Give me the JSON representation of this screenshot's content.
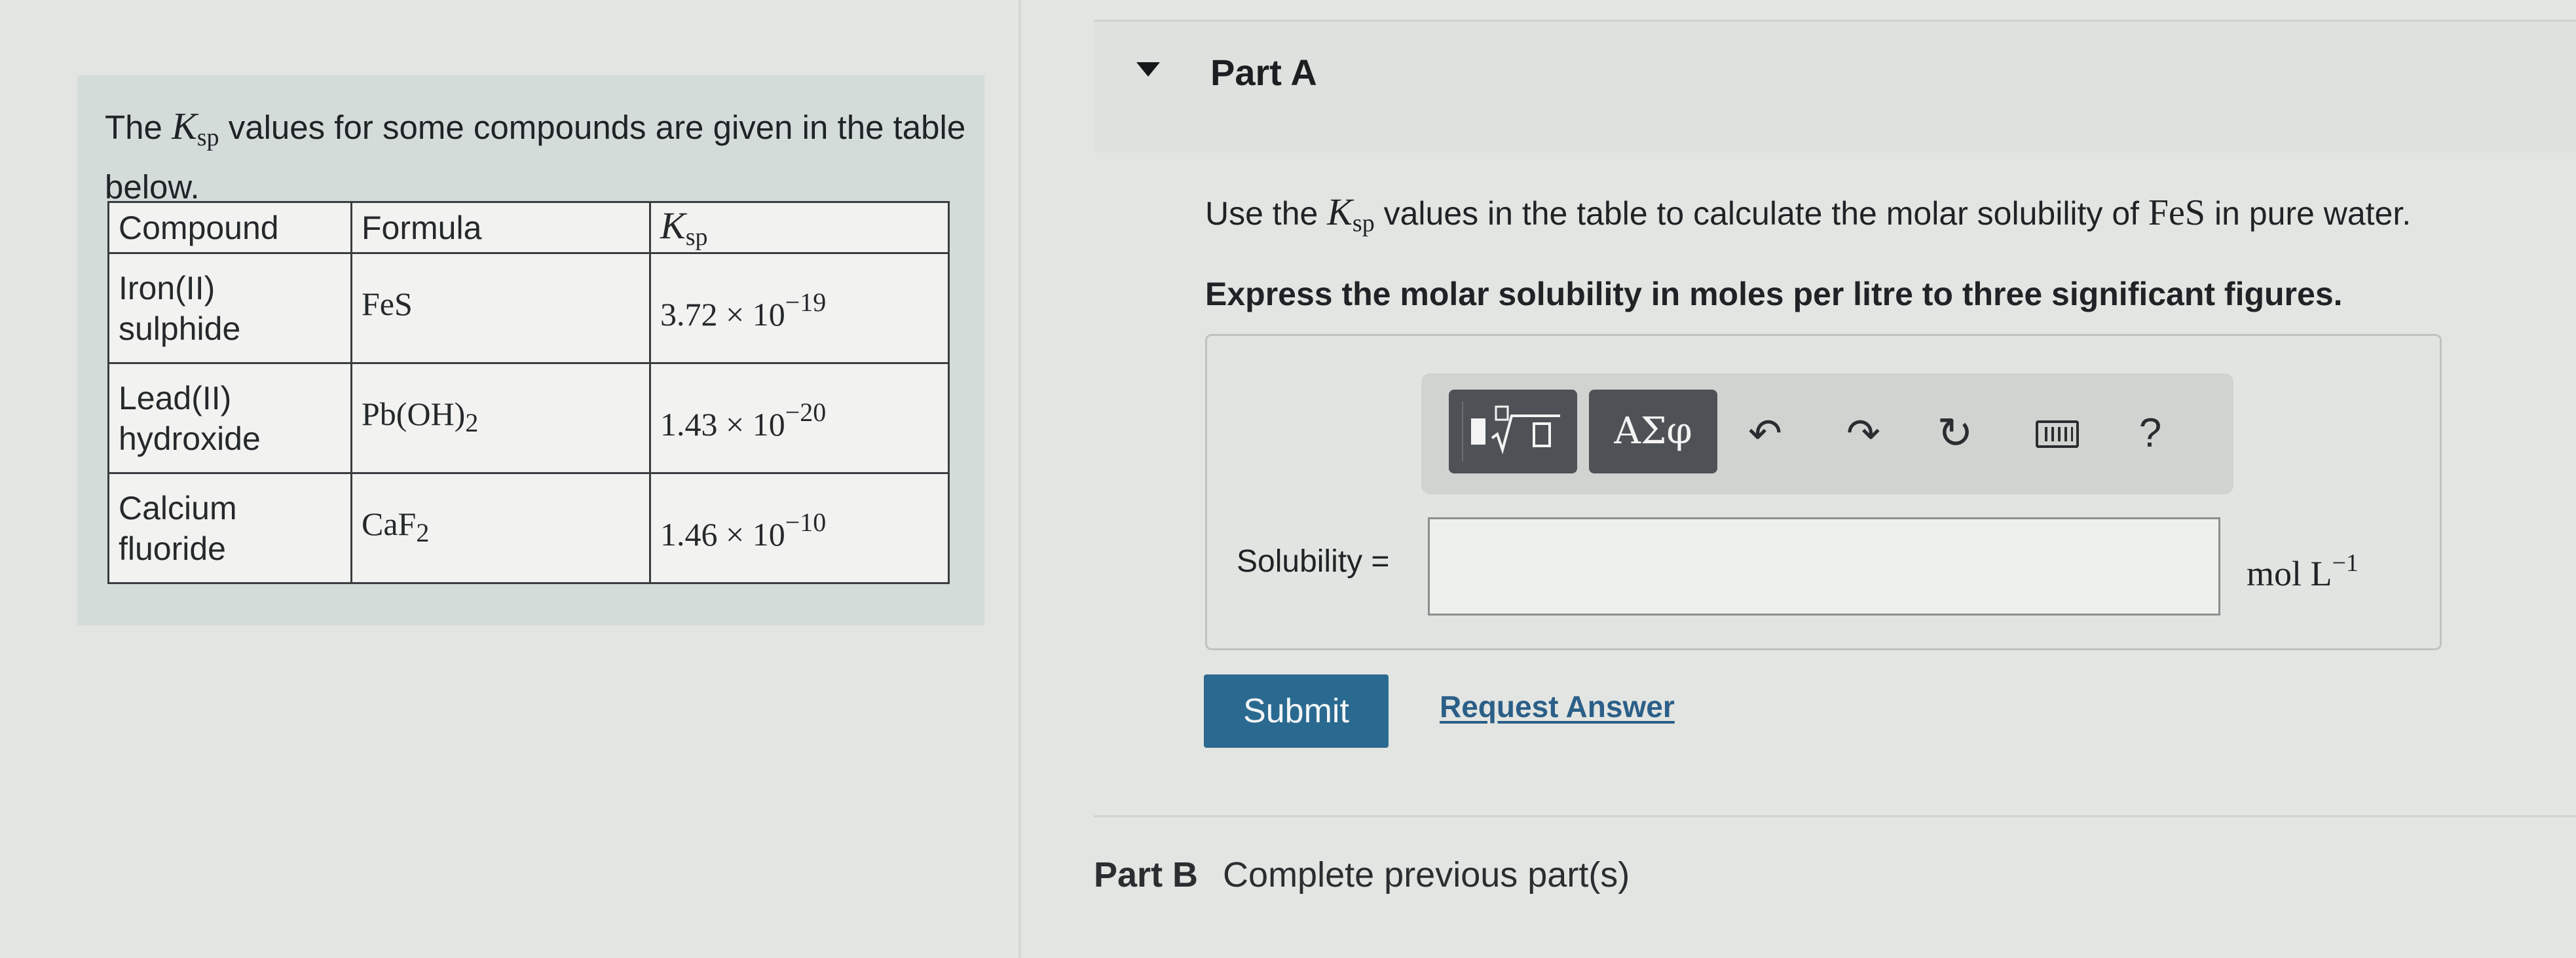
{
  "intro": {
    "before": "The ",
    "symbol": "K",
    "symbol_sub": "sp",
    "after": " values for some compounds are given in the table below."
  },
  "table": {
    "headers": [
      "Compound",
      "Formula",
      "K",
      "sp"
    ],
    "rows": [
      {
        "compound": "Iron(II) sulphide",
        "formula": "FeS",
        "formula_sub": "",
        "ksp_mantissa": "3.72 × 10",
        "ksp_exp": "−19"
      },
      {
        "compound": "Lead(II) hydroxide",
        "formula": "Pb(OH)",
        "formula_sub": "2",
        "ksp_mantissa": "1.43 × 10",
        "ksp_exp": "−20"
      },
      {
        "compound": "Calcium fluoride",
        "formula": "CaF",
        "formula_sub": "2",
        "ksp_mantissa": "1.46 × 10",
        "ksp_exp": "−10"
      }
    ]
  },
  "part_a": {
    "title": "Part A",
    "question_before": "Use the ",
    "question_symbol": "K",
    "question_sub": "sp",
    "question_middle": " values in the table to calculate the molar solubility of ",
    "question_formula": "FeS",
    "question_after": " in pure water.",
    "instruction": "Express the molar solubility in moles per litre to three significant figures.",
    "toolbar": {
      "symbols_label": "ΑΣφ",
      "undo_icon": "↶",
      "redo_icon": "↷",
      "reset_icon": "↻",
      "help_label": "?"
    },
    "input_label": "Solubility =",
    "input_value": "",
    "unit": "mol L",
    "unit_exp": "−1",
    "submit_label": "Submit",
    "request_label": "Request Answer"
  },
  "part_b": {
    "title": "Part B",
    "status": "Complete previous part(s)"
  },
  "colors": {
    "info_panel_bg": "#d3dcd9",
    "submit_bg": "#2a6a90",
    "link": "#2b5f88",
    "toolbar_button": "#4e5256"
  }
}
